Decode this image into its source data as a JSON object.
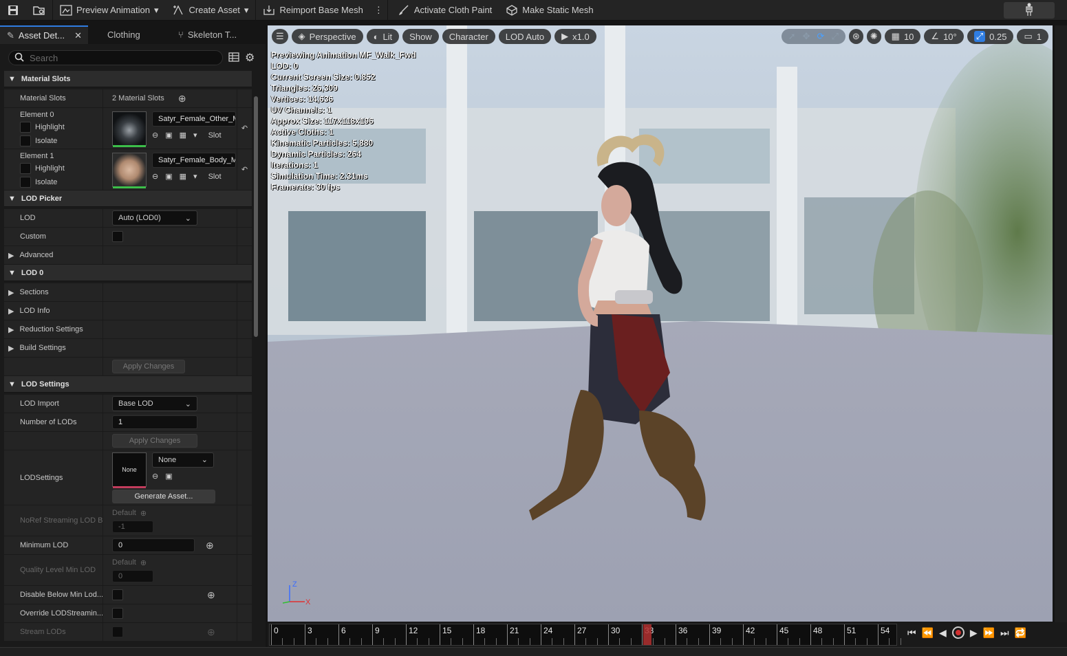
{
  "toolbar": {
    "preview_animation": "Preview Animation",
    "create_asset": "Create Asset",
    "reimport_base_mesh": "Reimport Base Mesh",
    "activate_cloth_paint": "Activate Cloth Paint",
    "make_static_mesh": "Make Static Mesh"
  },
  "tabs": {
    "asset_details": "Asset Det...",
    "clothing": "Clothing",
    "skeleton_tree": "Skeleton T..."
  },
  "search": {
    "placeholder": "Search"
  },
  "material_slots": {
    "header": "Material Slots",
    "label": "Material Slots",
    "count": "2 Material Slots",
    "elements": [
      {
        "name": "Element 0",
        "highlight": "Highlight",
        "isolate": "Isolate",
        "material": "Satyr_Female_Other_M",
        "slot": "Slot"
      },
      {
        "name": "Element 1",
        "highlight": "Highlight",
        "isolate": "Isolate",
        "material": "Satyr_Female_Body_M",
        "slot": "Slot"
      }
    ]
  },
  "lod_picker": {
    "header": "LOD Picker",
    "lod_label": "LOD",
    "lod_value": "Auto (LOD0)",
    "custom_label": "Custom",
    "advanced_label": "Advanced"
  },
  "lod0": {
    "header": "LOD 0",
    "sections": "Sections",
    "lod_info": "LOD Info",
    "reduction_settings": "Reduction Settings",
    "build_settings": "Build Settings",
    "apply_changes": "Apply Changes"
  },
  "lod_settings": {
    "header": "LOD Settings",
    "lod_import_label": "LOD Import",
    "lod_import_value": "Base LOD",
    "num_lods_label": "Number of LODs",
    "num_lods_value": "1",
    "apply_changes": "Apply Changes",
    "lodsettings_label": "LODSettings",
    "lodsettings_thumb": "None",
    "lodsettings_value": "None",
    "generate_asset": "Generate Asset...",
    "noref_label": "NoRef Streaming LOD B",
    "noref_default": "Default",
    "noref_value": "-1",
    "min_lod_label": "Minimum LOD",
    "min_lod_value": "0",
    "quality_label": "Quality Level Min LOD",
    "quality_default": "Default",
    "quality_value": "0",
    "disable_below_label": "Disable Below Min Lod...",
    "override_label": "Override LODStreamin...",
    "stream_lods_label": "Stream LODs"
  },
  "viewport": {
    "perspective": "Perspective",
    "lit": "Lit",
    "show": "Show",
    "character": "Character",
    "lod_auto": "LOD Auto",
    "play_speed": "x1.0",
    "grid_size": "10",
    "rotation_snap": "10°",
    "scale_snap": "0.25",
    "camera_speed": "1",
    "stats": [
      "Previewing Animation MF_Walk_Fwd",
      "LOD: 0",
      "Current Screen Size: 0.852",
      "Triangles: 26,309",
      "Vertices: 14,636",
      "UV Channels: 1",
      "Approx Size: 117x118x196",
      "Active Cloths: 1",
      "Kinematic Particles: 5,880",
      "Dynamic Particles: 264",
      "Iterations: 1",
      "Simulation Time: 2.31ms",
      "Framerate: 30 fps"
    ],
    "axis_z": "Z",
    "axis_x": "X"
  },
  "timeline": {
    "ticks": [
      "0",
      "3",
      "6",
      "9",
      "12",
      "15",
      "18",
      "21",
      "24",
      "27",
      "30",
      "33",
      "36",
      "39",
      "42",
      "45",
      "48",
      "51",
      "54"
    ],
    "current_frame": 33
  },
  "colors": {
    "accent": "#2f7de1",
    "thumb_bar": "#3cbf4a",
    "none_bar": "#c23c5c",
    "playhead": "#b13030",
    "record": "#d23030"
  }
}
